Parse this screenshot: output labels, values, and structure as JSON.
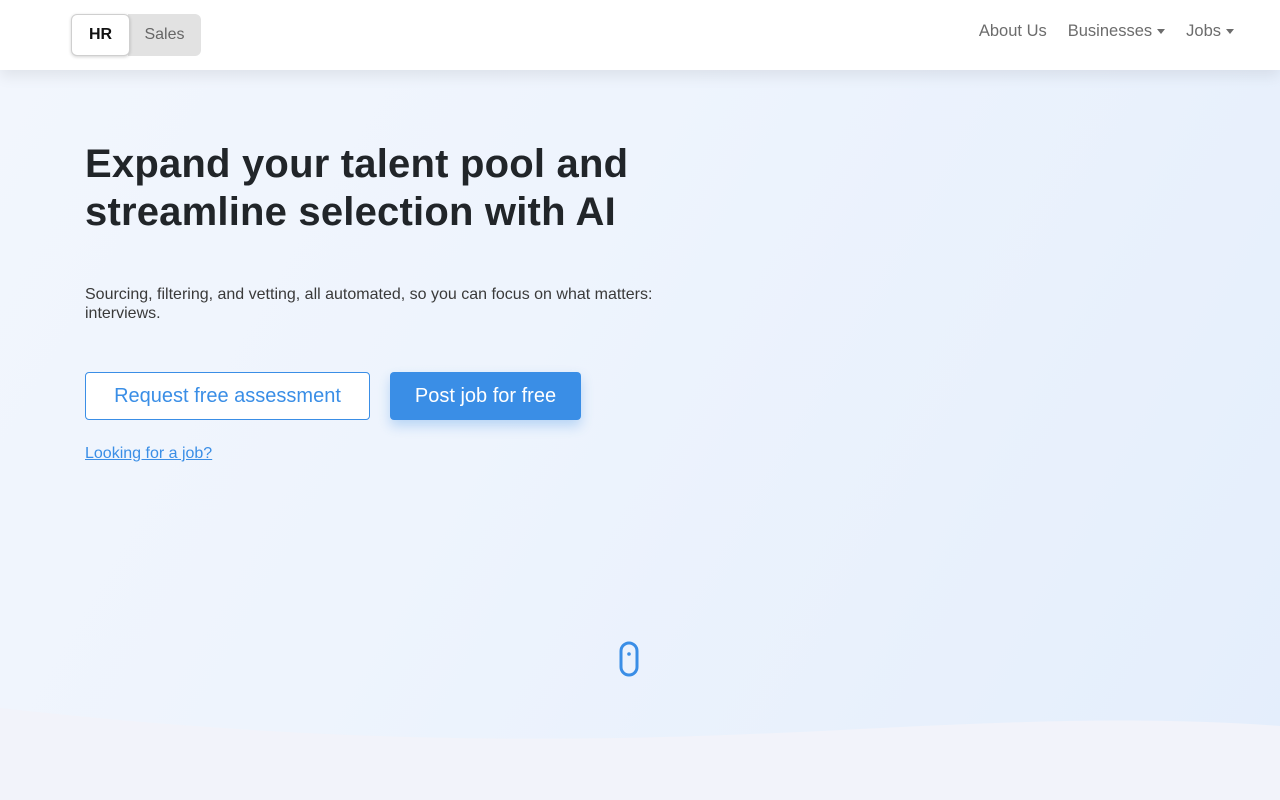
{
  "nav": {
    "toggle": {
      "hr": "HR",
      "sales": "Sales"
    },
    "links": {
      "about": "About Us",
      "businesses": "Businesses",
      "jobs": "Jobs"
    }
  },
  "hero": {
    "title": "Expand your talent pool and streamline selection with AI",
    "subtitle": "Sourcing, filtering, and vetting, all automated, so you can focus on what matters: interviews.",
    "cta_outline": "Request free assessment",
    "cta_primary": "Post job for free",
    "job_link": "Looking for a job?"
  },
  "icons": {
    "scroll": "mouse-scroll-icon",
    "caret": "caret-down-icon"
  },
  "colors": {
    "accent": "#3a8ee6",
    "nav_text": "#6c6c6c",
    "heading": "#212529"
  }
}
